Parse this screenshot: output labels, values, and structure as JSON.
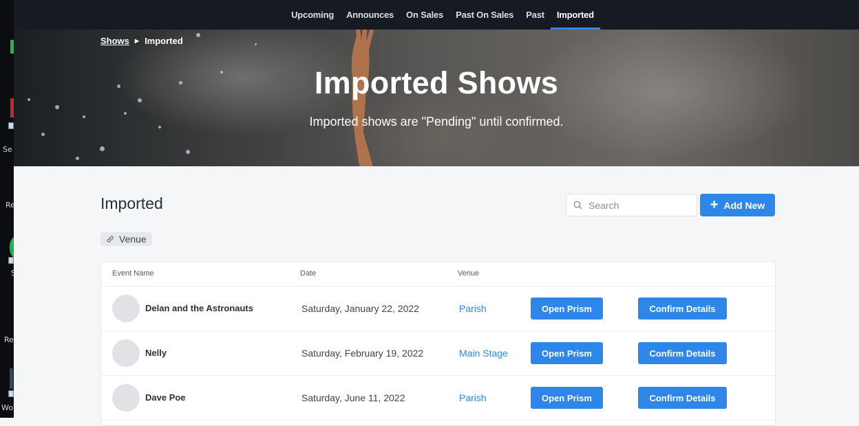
{
  "nav": {
    "tabs": [
      "Upcoming",
      "Announces",
      "On Sales",
      "Past On Sales",
      "Past",
      "Imported"
    ],
    "active": "Imported"
  },
  "breadcrumb": {
    "parent": "Shows",
    "current": "Imported"
  },
  "hero": {
    "title": "Imported Shows",
    "subtitle": "Imported shows are \"Pending\" until confirmed."
  },
  "section": {
    "title": "Imported"
  },
  "search": {
    "placeholder": "Search",
    "value": ""
  },
  "add_button": {
    "label": "Add New"
  },
  "filter_chip": {
    "label": "Venue"
  },
  "table": {
    "headers": {
      "event_name": "Event Name",
      "date": "Date",
      "venue": "Venue"
    },
    "rows": [
      {
        "name": "Delan and the Astronauts",
        "date": "Saturday, January 22, 2022",
        "venue": "Parish",
        "open_label": "Open Prism",
        "confirm_label": "Confirm Details"
      },
      {
        "name": "Nelly",
        "date": "Saturday, February 19, 2022",
        "venue": "Main Stage",
        "open_label": "Open Prism",
        "confirm_label": "Confirm Details"
      },
      {
        "name": "Dave Poe",
        "date": "Saturday, June 11, 2022",
        "venue": "Parish",
        "open_label": "Open Prism",
        "confirm_label": "Confirm Details"
      }
    ]
  },
  "desktop_labels": [
    "Se",
    "Re",
    "S",
    "Re",
    "Wo"
  ],
  "colors": {
    "accent": "#2e86e8",
    "nav_bg": "#161a22",
    "page_bg": "#f5f6f8"
  }
}
